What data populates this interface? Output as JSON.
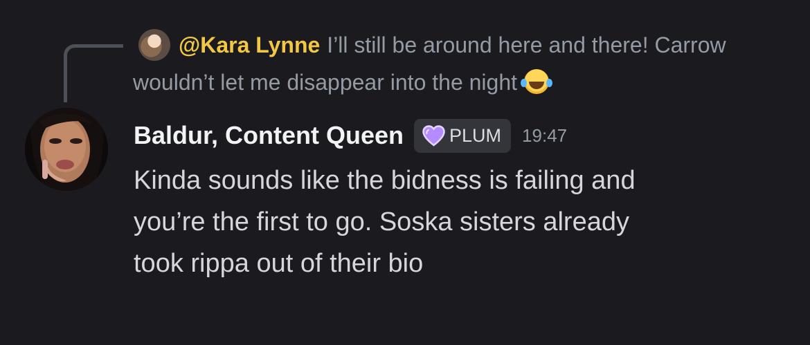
{
  "reply": {
    "author": "@Kara Lynne",
    "text": "I’ll still be around here and there! Carrow wouldn’t let me disappear into the night",
    "emoji": "joy-emoji",
    "author_color": "#f2c744"
  },
  "message": {
    "author": "Baldur, Content Queen",
    "badge": "PLUM",
    "badge_icon": "heart-icon",
    "badge_color": "#c9a4ff",
    "timestamp": "19:47",
    "content": "Kinda sounds like the bidness is failing and\nyou’re the first to go. Soska sisters already\ntook rippa out of their bio"
  },
  "colors": {
    "background": "#1b1b1f",
    "text": "#dbdee1",
    "muted": "#949ba4"
  }
}
